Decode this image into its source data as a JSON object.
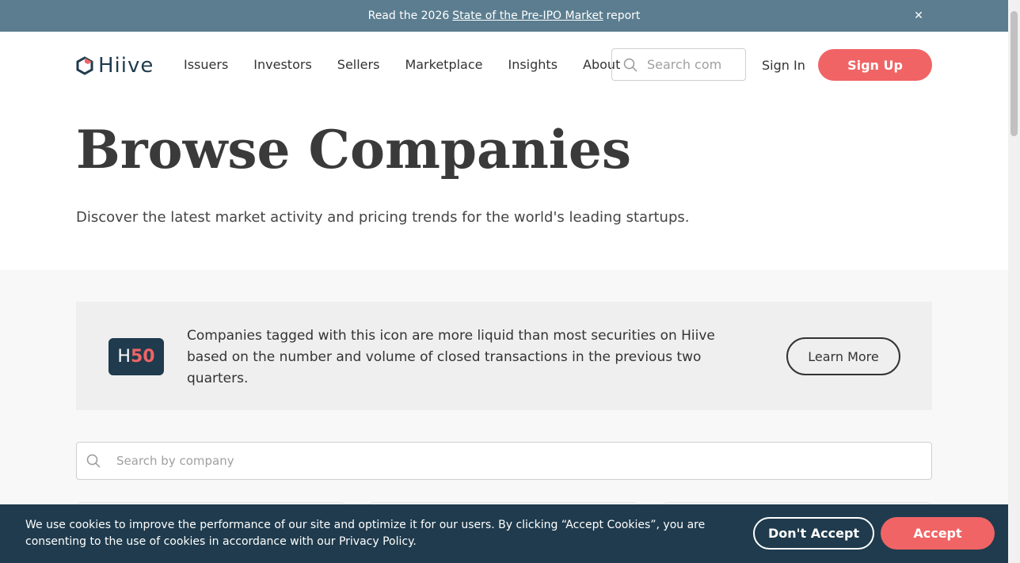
{
  "announcement": {
    "prefix": "Read the 2026",
    "link": "State of the Pre-IPO Market",
    "suffix": "report",
    "close_icon": "close-icon"
  },
  "header": {
    "logo_text": "Hiive",
    "nav": [
      "Issuers",
      "Investors",
      "Sellers",
      "Marketplace",
      "Insights",
      "About"
    ],
    "search_placeholder": "Search com",
    "sign_in": "Sign In",
    "sign_up": "Sign Up"
  },
  "hero": {
    "title": "Browse Companies",
    "subtitle": "Discover the latest market activity and pricing trends for the world's leading startups."
  },
  "h50_card": {
    "badge_h": "H",
    "badge_num": "50",
    "text": "Companies tagged with this icon are more liquid than most securities on Hiive based on the number and volume of closed transactions in the previous two quarters.",
    "button": "Learn More"
  },
  "company_search": {
    "placeholder": "Search by company"
  },
  "cookie_banner": {
    "text": "We use cookies to improve the performance of our site and optimize it for our users. By clicking “Accept Cookies”, you are consenting to the use of cookies in accordance with our Privacy Policy.",
    "dont_accept": "Don't Accept",
    "accept": "Accept"
  },
  "colors": {
    "announce_bg": "#5b7d8f",
    "brand_dark": "#1f3b4d",
    "accent": "#f06465"
  }
}
